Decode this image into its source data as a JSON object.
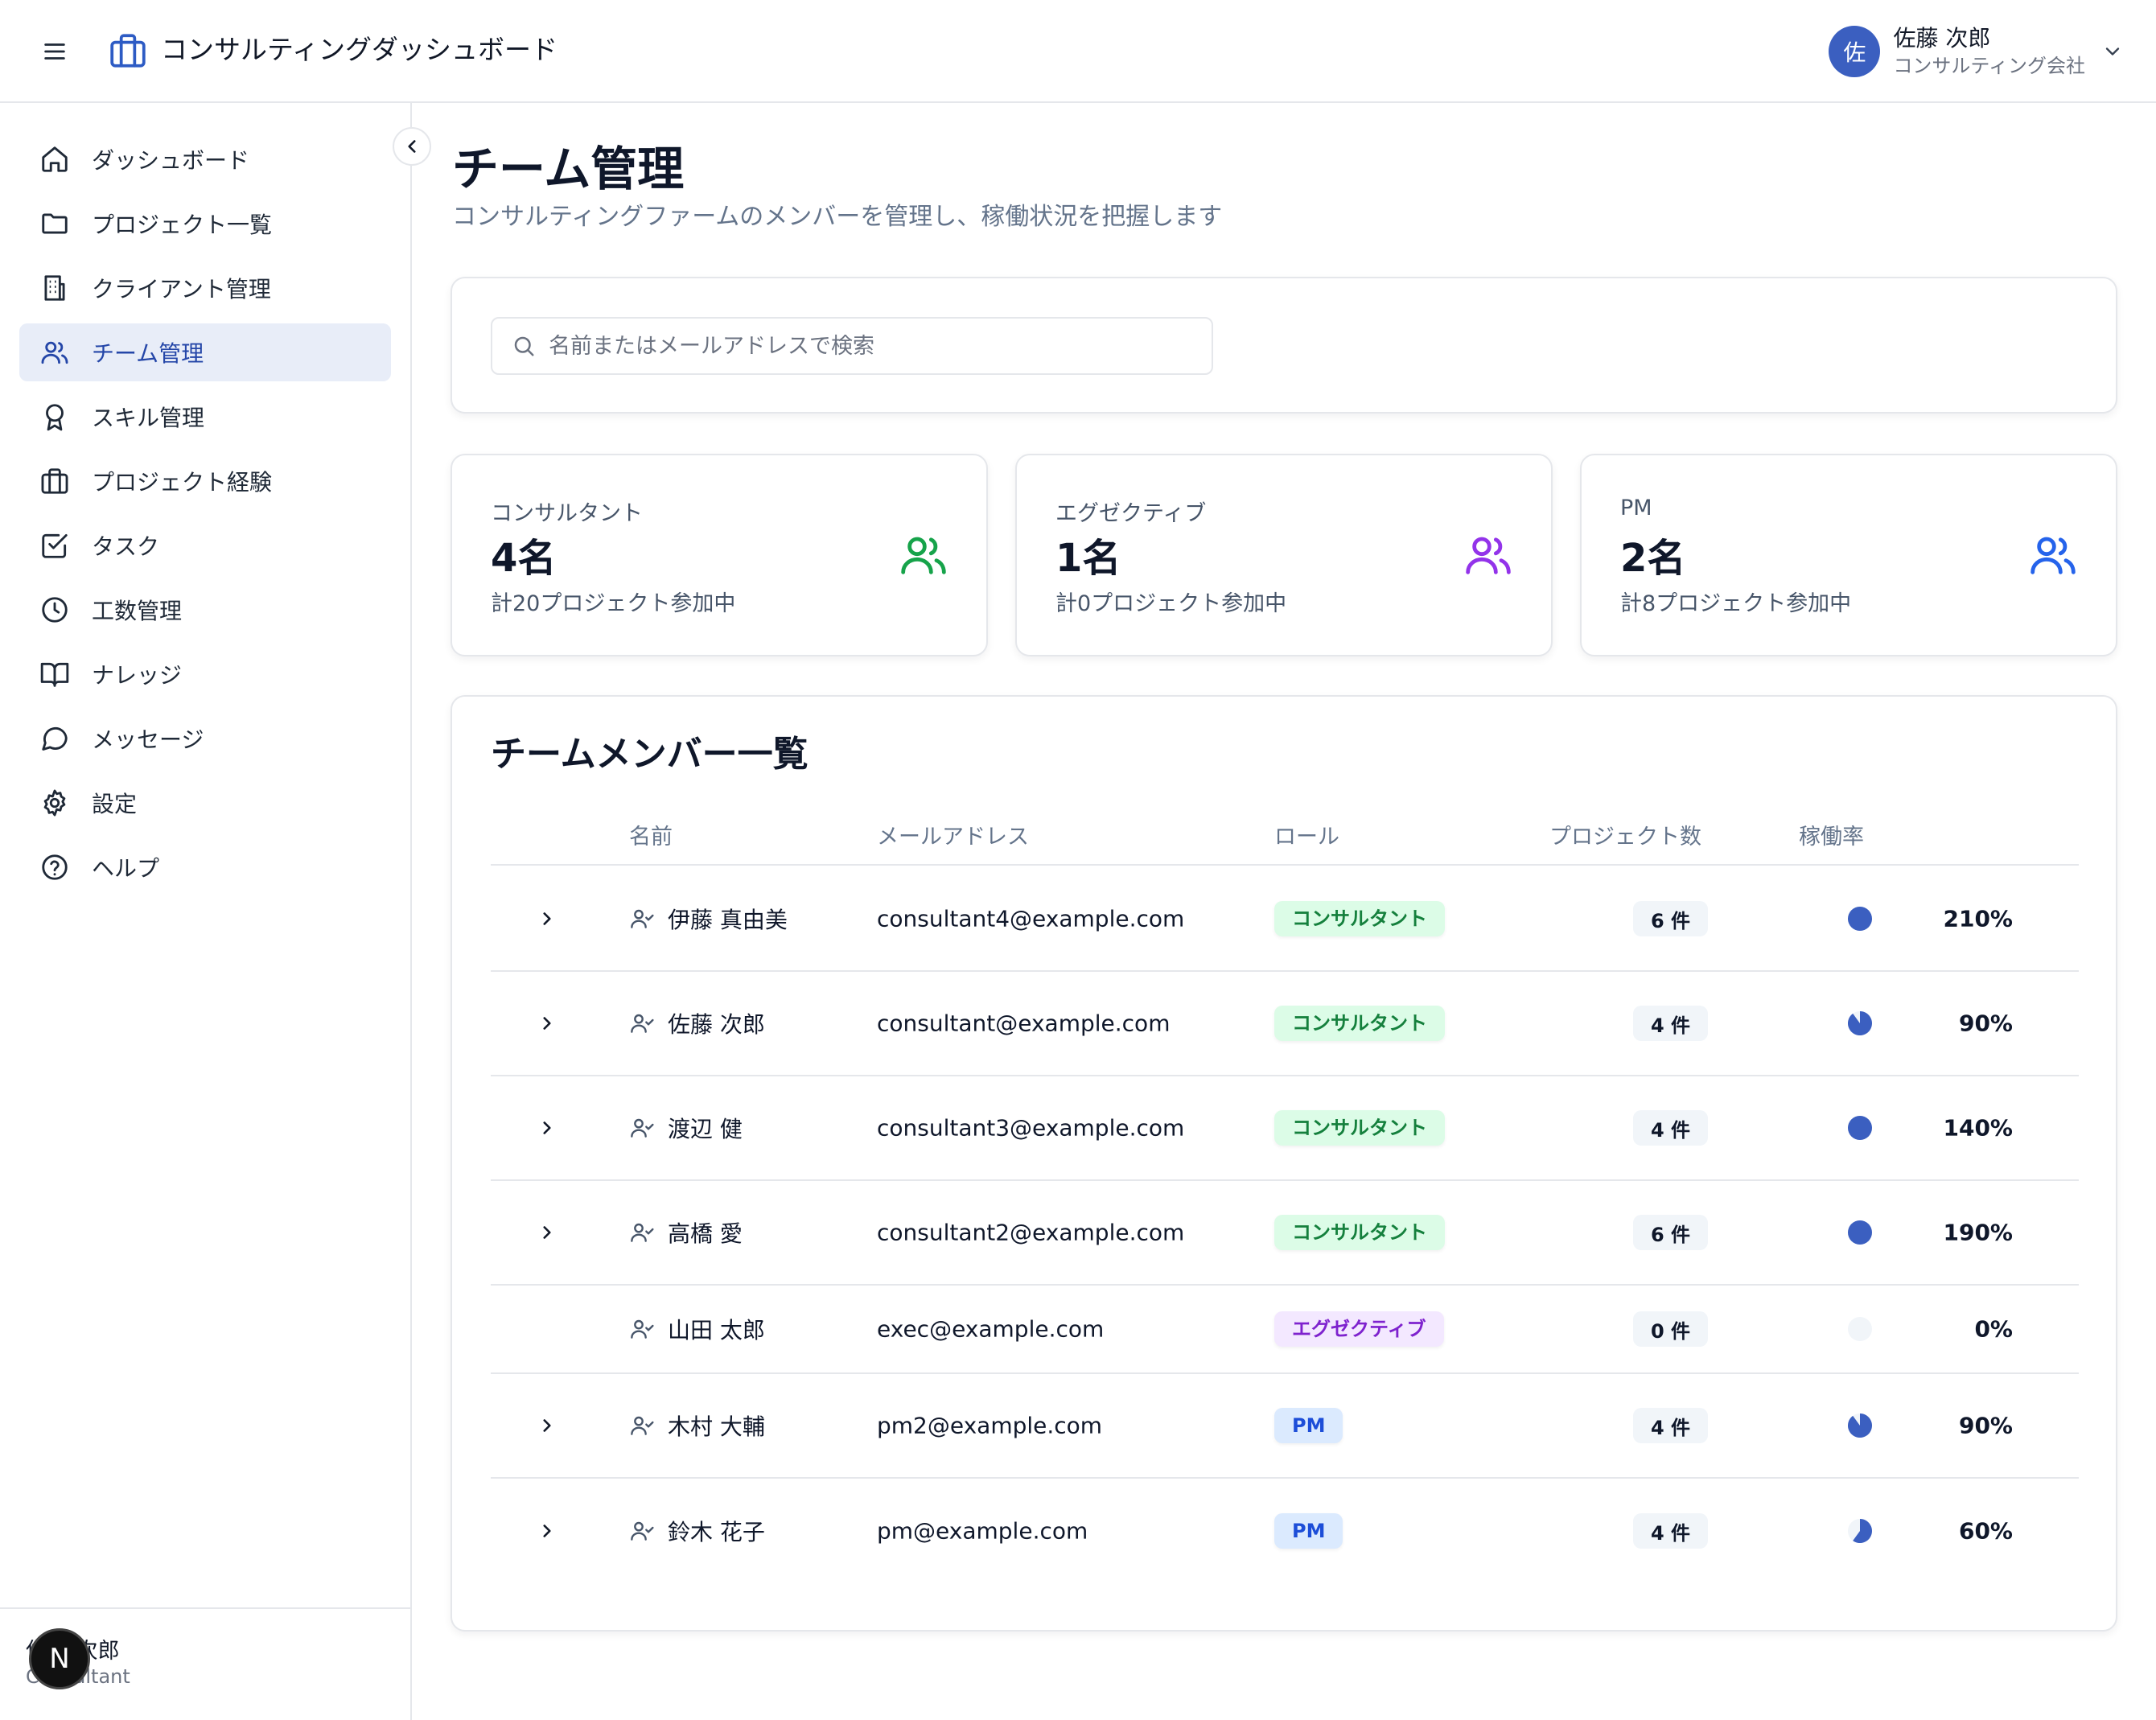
{
  "header": {
    "app_title": "コンサルティングダッシュボード",
    "user": {
      "avatar_initial": "佐",
      "name": "佐藤 次郎",
      "company": "コンサルティング会社"
    }
  },
  "sidebar": {
    "items": [
      {
        "label": "ダッシュボード",
        "icon": "home-icon",
        "active": false
      },
      {
        "label": "プロジェクト一覧",
        "icon": "folder-icon",
        "active": false
      },
      {
        "label": "クライアント管理",
        "icon": "building-icon",
        "active": false
      },
      {
        "label": "チーム管理",
        "icon": "users-icon",
        "active": true
      },
      {
        "label": "スキル管理",
        "icon": "award-icon",
        "active": false
      },
      {
        "label": "プロジェクト経験",
        "icon": "briefcase-icon",
        "active": false
      },
      {
        "label": "タスク",
        "icon": "checkbox-icon",
        "active": false
      },
      {
        "label": "工数管理",
        "icon": "clock-icon",
        "active": false
      },
      {
        "label": "ナレッジ",
        "icon": "book-icon",
        "active": false
      },
      {
        "label": "メッセージ",
        "icon": "message-icon",
        "active": false
      },
      {
        "label": "設定",
        "icon": "gear-icon",
        "active": false
      },
      {
        "label": "ヘルプ",
        "icon": "help-icon",
        "active": false
      }
    ],
    "footer": {
      "name": "佐藤 次郎",
      "role": "Consultant",
      "overlay_badge": "N"
    }
  },
  "main": {
    "title": "チーム管理",
    "subtitle": "コンサルティングファームのメンバーを管理し、稼働状況を把握します",
    "search": {
      "placeholder": "名前またはメールアドレスで検索",
      "value": ""
    },
    "stats": [
      {
        "label": "コンサルタント",
        "value": "4名",
        "sub": "計20プロジェクト参加中",
        "icon_color": "#16a34a"
      },
      {
        "label": "エグゼクティブ",
        "value": "1名",
        "sub": "計0プロジェクト参加中",
        "icon_color": "#9333ea"
      },
      {
        "label": "PM",
        "value": "2名",
        "sub": "計8プロジェクト参加中",
        "icon_color": "#2563eb"
      }
    ],
    "table": {
      "title": "チームメンバー一覧",
      "columns": [
        "名前",
        "メールアドレス",
        "ロール",
        "プロジェクト数",
        "稼働率"
      ],
      "rows": [
        {
          "name": "伊藤 真由美",
          "email": "consultant4@example.com",
          "role": "コンサルタント",
          "role_type": "consultant",
          "projects": "6 件",
          "utilization": "210%",
          "utilization_fraction": 1.0,
          "expandable": true
        },
        {
          "name": "佐藤 次郎",
          "email": "consultant@example.com",
          "role": "コンサルタント",
          "role_type": "consultant",
          "projects": "4 件",
          "utilization": "90%",
          "utilization_fraction": 0.9,
          "expandable": true
        },
        {
          "name": "渡辺 健",
          "email": "consultant3@example.com",
          "role": "コンサルタント",
          "role_type": "consultant",
          "projects": "4 件",
          "utilization": "140%",
          "utilization_fraction": 1.0,
          "expandable": true
        },
        {
          "name": "高橋 愛",
          "email": "consultant2@example.com",
          "role": "コンサルタント",
          "role_type": "consultant",
          "projects": "6 件",
          "utilization": "190%",
          "utilization_fraction": 1.0,
          "expandable": true
        },
        {
          "name": "山田 太郎",
          "email": "exec@example.com",
          "role": "エグゼクティブ",
          "role_type": "exec",
          "projects": "0 件",
          "utilization": "0%",
          "utilization_fraction": 0.0,
          "expandable": false
        },
        {
          "name": "木村 大輔",
          "email": "pm2@example.com",
          "role": "PM",
          "role_type": "pm",
          "projects": "4 件",
          "utilization": "90%",
          "utilization_fraction": 0.9,
          "expandable": true
        },
        {
          "name": "鈴木 花子",
          "email": "pm@example.com",
          "role": "PM",
          "role_type": "pm",
          "projects": "4 件",
          "utilization": "60%",
          "utilization_fraction": 0.6,
          "expandable": true
        }
      ]
    }
  },
  "colors": {
    "accent": "#3b5fc0",
    "active_nav_bg": "#e8edf8",
    "utilization_fill": "#3b5fc0",
    "utilization_empty": "#f1f5f9"
  }
}
